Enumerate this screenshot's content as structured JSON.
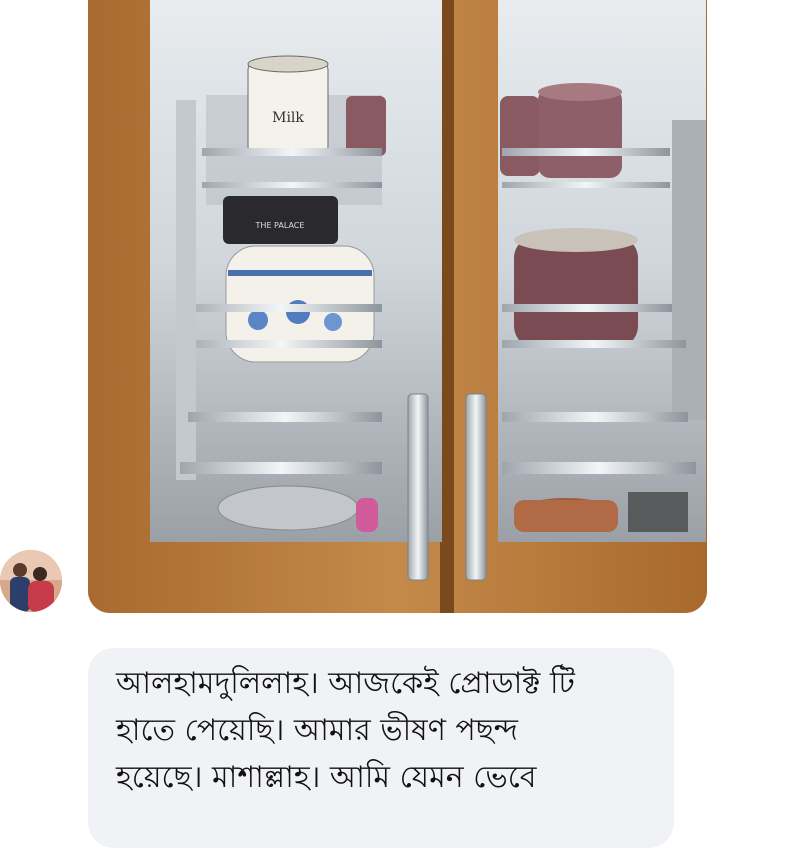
{
  "chat": {
    "image_message": {
      "label_milk": "Milk",
      "label_box": "THE PALACE"
    },
    "text_message": {
      "lines": [
        "আলহামদুলিলাহ। আজকেই প্রোডাক্ট টি",
        "হাতে পেয়েছি। আমার ভীষণ পছন্দ",
        "হয়েছে। মাশাল্লাহ। আমি যেমন ভেবে"
      ]
    },
    "sender": {
      "avatar_icon": "user-avatar-icon"
    }
  },
  "colors": {
    "bubble_bg": "#f0f2f5",
    "wood": "#b87a3c",
    "page_bg": "#ffffff"
  }
}
